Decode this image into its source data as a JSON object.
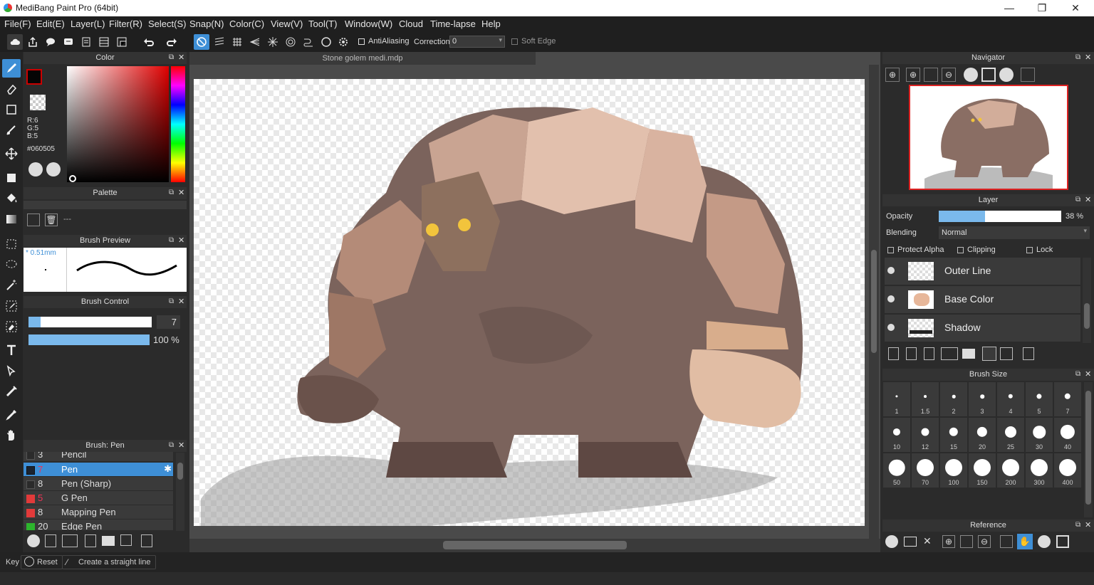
{
  "window": {
    "title": "MediBang Paint Pro (64bit)",
    "minimize": "—",
    "maximize": "❐",
    "close": "✕"
  },
  "menu": [
    "File(F)",
    "Edit(E)",
    "Layer(L)",
    "Filter(R)",
    "Select(S)",
    "Snap(N)",
    "Color(C)",
    "View(V)",
    "Tool(T)",
    "Window(W)",
    "Cloud",
    "Time-lapse",
    "Help"
  ],
  "toolbar": {
    "antialiasing": "AntiAliasing",
    "correction_label": "Correction",
    "correction_value": "0",
    "soft_edge": "Soft Edge"
  },
  "color_panel": {
    "title": "Color",
    "r": "R:6",
    "g": "G:5",
    "b": "B:5",
    "hex": "#060505",
    "primary": "#060505"
  },
  "palette_panel": {
    "title": "Palette",
    "value": "---"
  },
  "brush_preview": {
    "title": "Brush Preview",
    "size": "* 0.51mm"
  },
  "brush_control": {
    "title": "Brush Control",
    "size_value": "7",
    "opacity_value": "100 %",
    "size_fraction": 0.1,
    "opacity_fraction": 1.0
  },
  "brush_list": {
    "title": "Brush: Pen",
    "items": [
      {
        "num": "3",
        "name": "Pencil",
        "color": "#2b2b2b"
      },
      {
        "num": "7",
        "name": "Pen",
        "color": "#1b2430",
        "selected": true
      },
      {
        "num": "8",
        "name": "Pen (Sharp)",
        "color": "#2b2b2b"
      },
      {
        "num": "5",
        "name": "G Pen",
        "color": "#e23a3a"
      },
      {
        "num": "8",
        "name": "Mapping Pen",
        "color": "#e23a3a"
      },
      {
        "num": "20",
        "name": "Edge Pen",
        "color": "#2db52d"
      }
    ]
  },
  "document": {
    "tab": "Stone golem medi.mdp"
  },
  "navigator": {
    "title": "Navigator"
  },
  "layer_panel": {
    "title": "Layer",
    "opacity_label": "Opacity",
    "opacity_value": "38 %",
    "opacity_fraction": 0.38,
    "blending_label": "Blending",
    "blending_value": "Normal",
    "protect_alpha": "Protect Alpha",
    "clipping": "Clipping",
    "lock": "Lock",
    "layers": [
      {
        "name": "Outer Line"
      },
      {
        "name": "Base Color"
      },
      {
        "name": "Shadow"
      }
    ]
  },
  "brush_size": {
    "title": "Brush Size",
    "sizes": [
      "1",
      "1.5",
      "2",
      "3",
      "4",
      "5",
      "7",
      "10",
      "12",
      "15",
      "20",
      "25",
      "30",
      "40",
      "50",
      "70",
      "100",
      "150",
      "200",
      "300",
      "400"
    ]
  },
  "reference": {
    "title": "Reference"
  },
  "status": {
    "key": "Key",
    "reset": "Reset",
    "straight": "Create a straight line"
  }
}
